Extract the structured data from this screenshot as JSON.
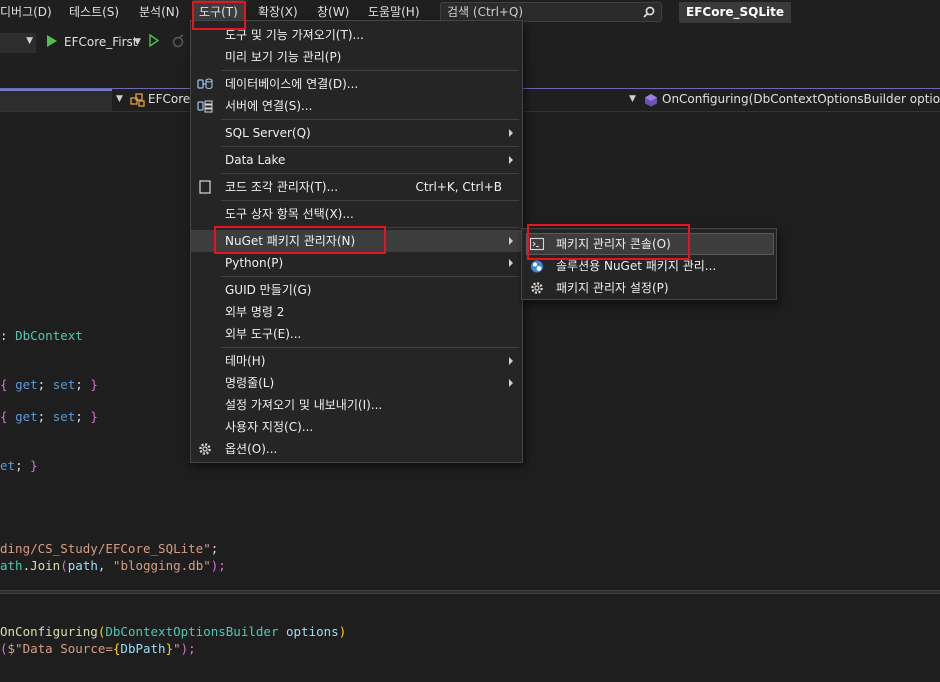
{
  "menubar": {
    "items": [
      "디버그(D)",
      "테스트(S)",
      "분석(N)",
      "도구(T)",
      "확장(X)",
      "창(W)",
      "도움말(H)"
    ],
    "search_placeholder": "검색 (Ctrl+Q)",
    "solution_name": "EFCore_SQLite"
  },
  "toolbar": {
    "startup_project": "EFCore_First"
  },
  "navbar": {
    "class_name": "EFCore_",
    "member": "OnConfiguring(DbContextOptionsBuilder options)"
  },
  "code": {
    "line1": {
      "a": ": ",
      "b": "DbContext"
    },
    "line2": {
      "open": "{ ",
      "get": "get",
      "semi1": "; ",
      "set": "set",
      "semi2": "; ",
      "close": "}"
    },
    "line3": {
      "open": "{ ",
      "get": "get",
      "semi1": "; ",
      "set": "set",
      "semi2": "; ",
      "close": "}"
    },
    "line4": {
      "a": "et",
      "semi": "; ",
      "close": "}"
    },
    "line5": {
      "str": "ding/CS_Study/EFCore_SQLite\"",
      "semi": ";"
    },
    "line6": {
      "a": "ath",
      "dot": ".",
      "method": "Join",
      "open": "(",
      "param": "path",
      "comma": ", ",
      "str": "\"blogging.db\"",
      "close": ");"
    },
    "line7": {
      "method": "OnConfiguring",
      "open": "(",
      "type": "DbContextOptionsBuilder",
      "sp": " ",
      "param": "options",
      "close": ")"
    },
    "line8": {
      "open": "(",
      "str1": "$\"Data Source=",
      "b1": "{",
      "prop": "DbPath",
      "b2": "}",
      "str2": "\"",
      "close": ");"
    }
  },
  "tools_menu": {
    "items": [
      "도구 및 기능 가져오기(T)...",
      "미리 보기 기능 관리(P)",
      "데이터베이스에 연결(D)...",
      "서버에 연결(S)...",
      "SQL Server(Q)",
      "Data Lake",
      "코드 조각 관리자(T)...",
      "도구 상자 항목 선택(X)...",
      "NuGet 패키지 관리자(N)",
      "Python(P)",
      "GUID 만들기(G)",
      "외부 명령 2",
      "외부 도구(E)...",
      "테마(H)",
      "명령줄(L)",
      "설정 가져오기 및 내보내기(I)...",
      "사용자 지정(C)...",
      "옵션(O)..."
    ],
    "snippet_shortcut": "Ctrl+K, Ctrl+B"
  },
  "nuget_submenu": {
    "items": [
      "패키지 관리자 콘솔(O)",
      "솔루션용 NuGet 패키지 관리...",
      "패키지 관리자 설정(P)"
    ]
  },
  "colors": {
    "highlight_box": "#e8141c",
    "menu_bg": "#252526",
    "editor_bg": "#1e1e1e"
  }
}
